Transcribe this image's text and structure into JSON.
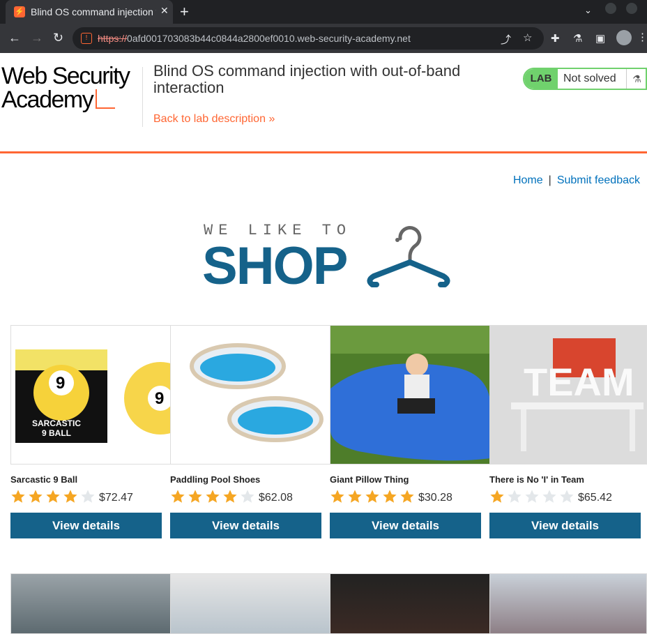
{
  "browser": {
    "tab_title": "Blind OS command injection with out-of-band interaction",
    "url_scheme": "https://",
    "url_rest": "0afd001703083b44c0844a2800ef0010.web-security-academy.net"
  },
  "academy": {
    "logo_line1": "Web Security",
    "logo_line2": "Academy",
    "lab_title": "Blind OS command injection with out-of-band interaction",
    "back_link": "Back to lab description",
    "lab_label": "LAB",
    "lab_status": "Not solved"
  },
  "nav": {
    "home": "Home",
    "separator": "|",
    "feedback": "Submit feedback"
  },
  "brand": {
    "small": "WE LIKE TO",
    "big": "SHOP"
  },
  "products": [
    {
      "name": "Sarcastic 9 Ball",
      "rating": 4,
      "price": "$72.47",
      "button": "View details"
    },
    {
      "name": "Paddling Pool Shoes",
      "rating": 4,
      "price": "$62.08",
      "button": "View details"
    },
    {
      "name": "Giant Pillow Thing",
      "rating": 5,
      "price": "$30.28",
      "button": "View details"
    },
    {
      "name": "There is No 'I' in Team",
      "rating": 1,
      "price": "$65.42",
      "button": "View details"
    }
  ],
  "colors": {
    "accent": "#ff6633",
    "primary": "#15628a",
    "link": "#0071bc",
    "star_on": "#f5a623",
    "star_off": "#e3e7ea"
  }
}
